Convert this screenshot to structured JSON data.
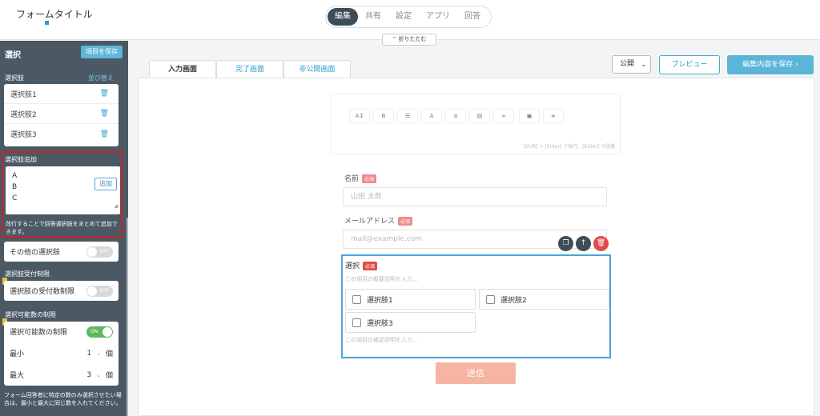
{
  "header": {
    "form_title": "フォームタイトル",
    "nav": [
      "編集",
      "共有",
      "設定",
      "アプリ",
      "回答"
    ],
    "fold_label": "折りたたむ"
  },
  "sidebar": {
    "title": "選択",
    "save_item_label": "項目を保存",
    "choices_label": "選択肢",
    "sort_label": "並び替え",
    "choices": [
      "選択肢1",
      "選択肢2",
      "選択肢3"
    ],
    "add_choice_label": "選択肢追加",
    "add_choice_value": "A\nB\nC",
    "add_button": "追加",
    "add_help": "改行することで回答選択肢をまとめて追加できます。",
    "other_choice_label": "その他の選択肢",
    "toggle_off": "OFF",
    "toggle_on": "ON",
    "limit_section_label": "選択肢受付制限",
    "limit_label": "選択肢の受付数制限",
    "count_section_label": "選択可能数の制限",
    "count_label": "選択可能数の制限",
    "min_label": "最小",
    "min_value": "1",
    "max_label": "最大",
    "max_value": "3",
    "unit": "個",
    "footer_note": "フォーム回答者に特定の数のみ選択させたい場合は、最小と最大に同じ数を入れてください。"
  },
  "tabs": [
    "入力画面",
    "完了画面",
    "非公開画面"
  ],
  "toolbar": {
    "publish_select": "公開",
    "preview_label": "プレビュー",
    "save_label": "編集内容を保存"
  },
  "editor": {
    "tools": [
      "A↕",
      "B",
      "☰",
      "A",
      "≡",
      "▤",
      "∞",
      "▣",
      "≑"
    ],
    "hint": "[Shift] + [Enter] で改行、[Enter] で段落"
  },
  "fields": {
    "name_label": "名前",
    "name_placeholder": "山田 太郎",
    "email_label": "メールアドレス",
    "email_placeholder": "mail@example.com",
    "required_badge": "必須",
    "select_label": "選択",
    "select_desc_placeholder": "この項目の概要説明を入力...",
    "select_options": [
      "選択肢1",
      "選択肢2",
      "選択肢3"
    ],
    "select_footer_placeholder": "この項目の補足説明を入力..."
  },
  "submit_label": "送信",
  "colors": {
    "sidebar_bg": "#4a5964",
    "accent": "#5ab5d8",
    "highlight": "#c8242a",
    "submit": "#f6b5a2"
  }
}
